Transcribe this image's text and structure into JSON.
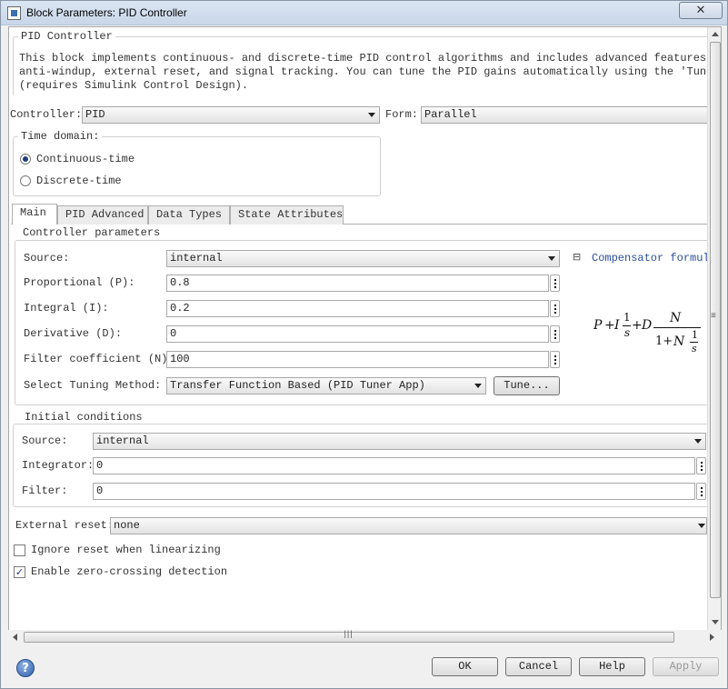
{
  "window": {
    "title": "Block Parameters: PID Controller",
    "close_label": "✕"
  },
  "block": {
    "name": "PID Controller",
    "description_lines": [
      "This block implements continuous- and discrete-time PID control algorithms and includes advanced features such as",
      "anti-windup, external reset, and signal tracking. You can tune the PID gains automatically using the 'Tune...' button",
      "(requires Simulink Control Design)."
    ]
  },
  "controller": {
    "label": "Controller:",
    "value": "PID",
    "form_label": "Form:",
    "form_value": "Parallel"
  },
  "time_domain": {
    "legend": "Time domain:",
    "options": [
      {
        "label": "Continuous-time",
        "selected": true
      },
      {
        "label": "Discrete-time",
        "selected": false
      }
    ]
  },
  "tabs": [
    {
      "label": "Main",
      "active": true
    },
    {
      "label": "PID Advanced",
      "active": false
    },
    {
      "label": "Data Types",
      "active": false
    },
    {
      "label": "State Attributes",
      "active": false
    }
  ],
  "controller_parameters": {
    "legend": "Controller parameters",
    "source_label": "Source:",
    "source_value": "internal",
    "proportional_label": "Proportional (P):",
    "proportional_value": "0.8",
    "integral_label": "Integral (I):",
    "integral_value": "0.2",
    "derivative_label": "Derivative (D):",
    "derivative_value": "0",
    "filter_label": "Filter coefficient (N):",
    "filter_value": "100",
    "tuning_label": "Select Tuning Method:",
    "tuning_value": "Transfer Function Based (PID Tuner App)",
    "tune_button": "Tune...",
    "compensator_toggle": "⊟",
    "compensator_label": "Compensator formula"
  },
  "formula": {
    "p": "P",
    "plus1": "+",
    "i": "I",
    "one1": "1",
    "s1": "s",
    "plus2": "+",
    "d": "D",
    "n_num": "N",
    "one_plus": "1+",
    "n_den": "N",
    "one2": "1",
    "s2": "s"
  },
  "initial_conditions": {
    "legend": "Initial conditions",
    "source_label": "Source:",
    "source_value": "internal",
    "integrator_label": "Integrator:",
    "integrator_value": "0",
    "filter_label": "Filter:",
    "filter_value": "0"
  },
  "external_reset": {
    "label": "External reset:",
    "value": "none"
  },
  "options": {
    "ignore_reset_label": "Ignore reset when linearizing",
    "ignore_reset_checked": false,
    "zero_crossing_label": "Enable zero-crossing detection",
    "zero_crossing_checked": true
  },
  "scrollbar": {
    "grip": "≡",
    "hgrip": "|||"
  },
  "buttons": {
    "ok": "OK",
    "cancel": "Cancel",
    "help": "Help",
    "apply": "Apply",
    "help_icon": "?"
  }
}
